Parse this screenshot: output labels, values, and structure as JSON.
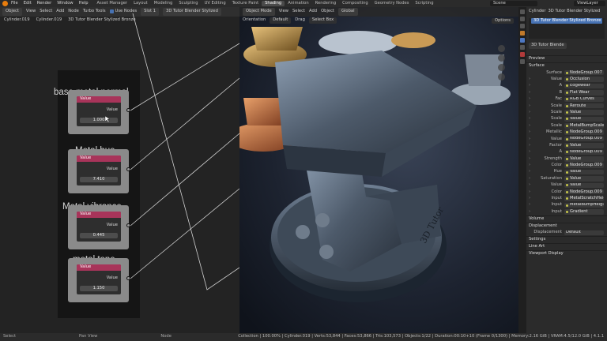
{
  "topbar": {
    "menus": [
      "File",
      "Edit",
      "Render",
      "Window",
      "Help"
    ],
    "workspaces": [
      "Asset Manager",
      "Layout",
      "Modeling",
      "Sculpting",
      "UV Editing",
      "Texture Paint",
      "Shading",
      "Animation",
      "Rendering",
      "Compositing",
      "Geometry Nodes",
      "Scripting"
    ],
    "active_workspace": "Shading",
    "scene": "Scene",
    "view_layer": "ViewLayer"
  },
  "node_editor": {
    "header": {
      "mode": "Object",
      "view": "View",
      "select": "Select",
      "add": "Add",
      "node": "Node",
      "turbo": "Turbo Tools",
      "use_nodes": "Use Nodes",
      "slot": "Slot 1",
      "material": "3D Tutor Blender Stylized"
    },
    "breadcrumb": [
      "Cylinder.019",
      "Cylinder.019",
      "3D Tutor Blender Stylized Bronze"
    ],
    "groups": [
      {
        "title": "base metal normal",
        "header": "Value",
        "output": "Value",
        "value": "1.000"
      },
      {
        "title": "Metal hue",
        "header": "Value",
        "output": "Value",
        "value": "7.410"
      },
      {
        "title": "Metal vibrance",
        "header": "Value",
        "output": "Value",
        "value": "0.445"
      },
      {
        "title": "metal tone",
        "header": "Value",
        "output": "Value",
        "value": "1.150"
      }
    ]
  },
  "viewport": {
    "header": {
      "editor": "Object Mode",
      "view": "View",
      "select": "Select",
      "add": "Add",
      "object": "Object",
      "orientation": "Global"
    },
    "subheader": {
      "orientation": "Orientation",
      "default": "Default",
      "drag": "Drag",
      "select_box": "Select Box"
    },
    "options": "Options",
    "engraving": "3D Tutor"
  },
  "properties": {
    "object": "Cylinder",
    "material": "3D Tutor Blender Stylized",
    "slot": "3D Tutor Blender Stylized Bronze",
    "data_block": "3D Tutor Blende",
    "sections": {
      "preview": "Preview",
      "surface": "Surface",
      "volume": "Volume",
      "displacement": "Displacement",
      "settings": "Settings",
      "line_art": "Line Art",
      "viewport_display": "Viewport Display"
    },
    "rows": [
      {
        "label": "Surface",
        "value": "NodeGroup.007"
      },
      {
        "label": "Value",
        "value": "Occlusion"
      },
      {
        "label": "A",
        "value": "Edgewear"
      },
      {
        "label": "B",
        "value": "Flat Wear"
      },
      {
        "label": "Fac",
        "value": "RGB Curves"
      },
      {
        "label": "Scale",
        "value": "Reroute"
      },
      {
        "label": "Scale",
        "value": "Value"
      },
      {
        "label": "Scale",
        "value": "Value"
      },
      {
        "label": "Scale",
        "value": "MetalBumpScale"
      },
      {
        "label": "Metallic",
        "value": "NodeGroup.009 | Co"
      },
      {
        "label": "Value",
        "value": "NodeGroup.009 | Co"
      },
      {
        "label": "Factor",
        "value": "Value"
      },
      {
        "label": "A",
        "value": "NodeGroup.009 | Co"
      },
      {
        "label": "Strength",
        "value": "Value"
      },
      {
        "label": "Color",
        "value": "NodeGroup.009 | Co"
      },
      {
        "label": "Hue",
        "value": "Value"
      },
      {
        "label": "Saturation",
        "value": "Value"
      },
      {
        "label": "Value",
        "value": "Value"
      },
      {
        "label": "Color",
        "value": "NodeGroup.009 | Co"
      },
      {
        "label": "Input",
        "value": "MetalScratchHeight"
      },
      {
        "label": "Input",
        "value": "MetalBumpHeight"
      },
      {
        "label": "Input",
        "value": "Gradient"
      }
    ],
    "displacement": {
      "label": "Displacement",
      "value": "Default"
    }
  },
  "statusbar": {
    "select": "Select",
    "pan": "Pan View",
    "node": "Node",
    "stats": "Collection | 100.00% | Cylinder.019 | Verts:53,844 | Faces:53,866 | Tris:103,573 | Objects:1/22 | Duration:00:10+10 (Frame 0/1300) | Memory:2.16 GiB | VRAM:4.5/12.0 GiB | 4.1.1"
  }
}
